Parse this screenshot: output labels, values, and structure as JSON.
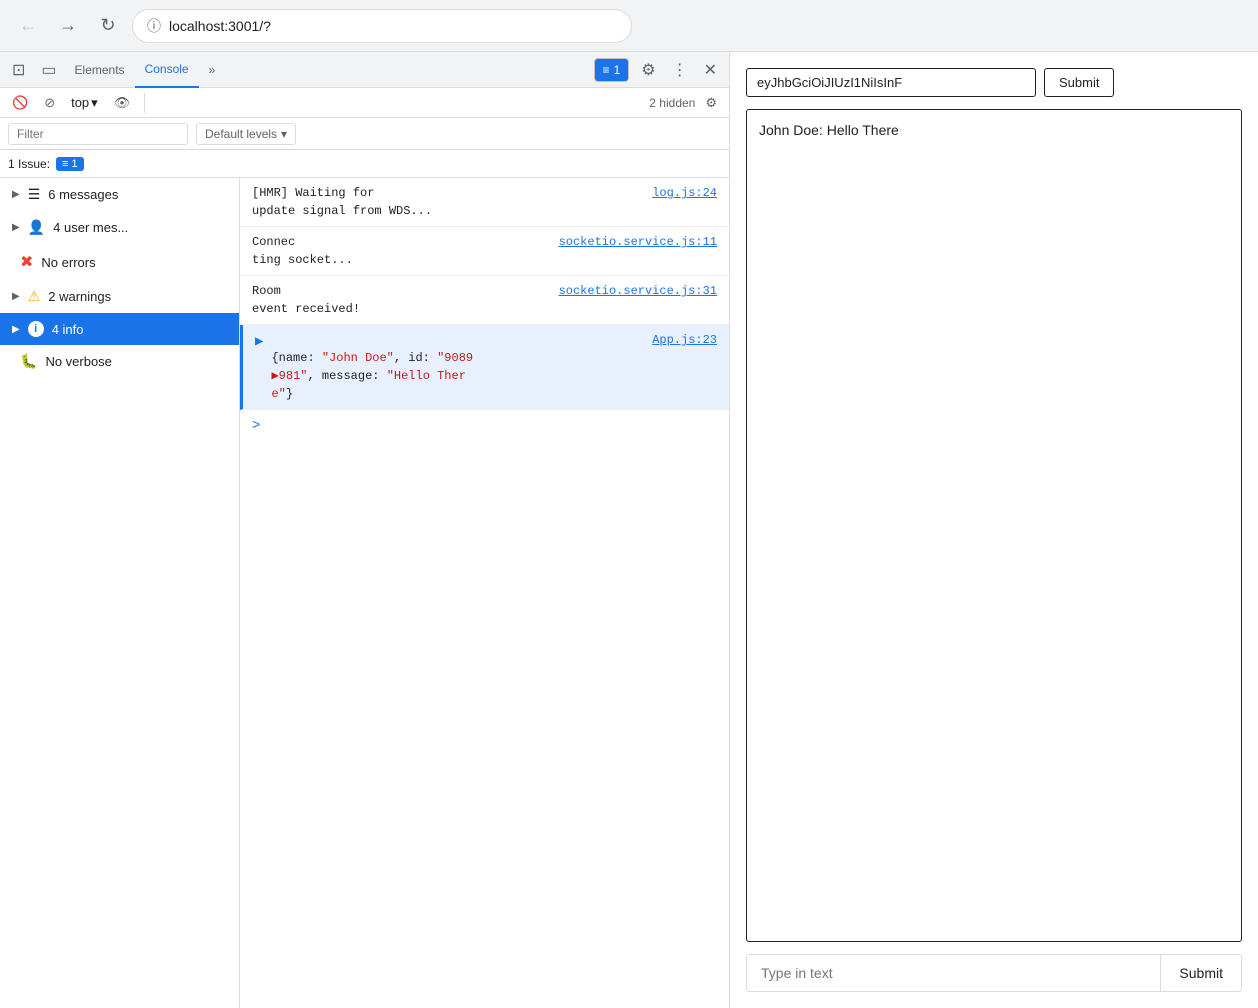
{
  "browser": {
    "back_label": "←",
    "forward_label": "→",
    "reload_label": "↻",
    "url": "localhost:3001/?",
    "info_icon": "ⓘ"
  },
  "devtools": {
    "tabs": [
      {
        "label": "Elements",
        "active": false
      },
      {
        "label": "Console",
        "active": true
      },
      {
        "label": "»",
        "active": false
      }
    ],
    "badge_count": "1",
    "close_label": "✕",
    "more_label": "⋮",
    "gear_label": "⚙",
    "console_tab_label": "Console"
  },
  "console_toolbar": {
    "clear_label": "🚫",
    "stop_label": "⊘",
    "top_label": "top",
    "dropdown_arrow": "▾",
    "eye_label": "👁",
    "hidden_count": "2 hidden",
    "gear_label": "⚙"
  },
  "filter_bar": {
    "placeholder": "Filter",
    "levels_label": "Default levels",
    "dropdown_arrow": "▾"
  },
  "issue_bar": {
    "text": "1 Issue:",
    "badge_icon": "≡",
    "badge_count": "1"
  },
  "sidebar": {
    "items": [
      {
        "label": "6 messages",
        "icon": "list",
        "arrow": "▶",
        "active": false
      },
      {
        "label": "4 user mes...",
        "icon": "user",
        "arrow": "▶",
        "active": false
      },
      {
        "label": "No errors",
        "icon": "error",
        "arrow": "",
        "active": false
      },
      {
        "label": "2 warnings",
        "icon": "warning",
        "arrow": "▶",
        "active": false
      },
      {
        "label": "4 info",
        "icon": "info",
        "arrow": "▶",
        "active": true
      },
      {
        "label": "No verbose",
        "icon": "bug",
        "arrow": "",
        "active": false
      }
    ]
  },
  "console_entries": [
    {
      "type": "normal",
      "text": "[HMR] Waiting for     update signal from WDS...",
      "source": "log.js:24",
      "source_link": true
    },
    {
      "type": "normal",
      "text": "Connec     ting socket...",
      "source": "socketio.service.js:11",
      "source_link": true
    },
    {
      "type": "normal",
      "text": "Room     event received!",
      "source": "socketio.service.js:31",
      "source_link": true
    },
    {
      "type": "info",
      "source": "App.js:23",
      "source_link": true,
      "json_text": "{name: \"John Doe\", id: \"9089▶981\", message: \"Hello There\"}"
    }
  ],
  "prompt": {
    "chevron": ">"
  },
  "app": {
    "token_value": "eyJhbGciOiJIUzI1NiIsInF",
    "token_placeholder": "eyJhbGciOiJIUzI1NiIsInF",
    "submit_label": "Submit",
    "chat_message": "John Doe: Hello There",
    "type_placeholder": "Type in text",
    "type_submit_label": "Submit"
  }
}
